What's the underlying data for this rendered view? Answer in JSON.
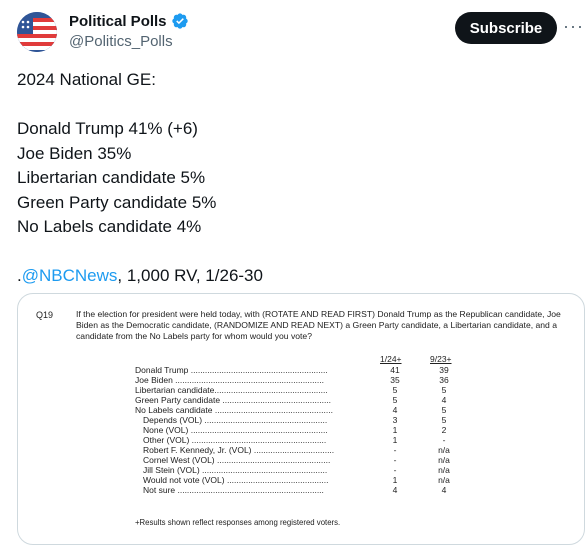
{
  "author": {
    "display_name": "Political Polls",
    "handle": "@Politics_Polls"
  },
  "actions": {
    "subscribe_label": "Subscribe",
    "more_label": "···"
  },
  "tweet": {
    "line1": "2024 National GE:",
    "line2": "Donald Trump 41% (+6)",
    "line3": "Joe Biden 35%",
    "line4": "Libertarian candidate 5%",
    "line5": "Green Party candidate 5%",
    "line6": "No Labels candidate 4%",
    "source_prefix": ".",
    "mention": "@NBCNews",
    "source_suffix": ", 1,000 RV, 1/26-30"
  },
  "colors": {
    "accent": "#1d9bf0",
    "text": "#0f1419",
    "muted": "#536471",
    "verified": "#1d9bf0"
  },
  "poll_image": {
    "question_number": "Q19",
    "question_text": "If the election for president were held today, with (ROTATE AND READ FIRST) Donald Trump as the Republican candidate, Joe Biden as the Democratic candidate, (RANDOMIZE AND READ NEXT) a Green Party candidate, a Libertarian candidate, and a candidate from the No Labels party for whom would you vote?",
    "col1_header": "1/24+",
    "col2_header": "9/23+",
    "rows": [
      {
        "label": "Donald Trump ..........................................................",
        "v1": "41",
        "v2": "39"
      },
      {
        "label": "Joe Biden ...............................................................",
        "v1": "35",
        "v2": "36"
      },
      {
        "label": "Libertarian candidate................................................",
        "v1": "5",
        "v2": "5"
      },
      {
        "label": "Green Party candidate ..............................................",
        "v1": "5",
        "v2": "4"
      },
      {
        "label": "No Labels candidate ..................................................",
        "v1": "4",
        "v2": "5"
      },
      {
        "label": "Depends (VOL) ....................................................",
        "v1": "3",
        "v2": "5"
      },
      {
        "label": "None (VOL) ..........................................................",
        "v1": "1",
        "v2": "2"
      },
      {
        "label": "Other (VOL) .........................................................",
        "v1": "1",
        "v2": "-"
      },
      {
        "label": "Robert F. Kennedy, Jr. (VOL) ..................................",
        "v1": "-",
        "v2": "n/a"
      },
      {
        "label": "Cornel West (VOL) ................................................",
        "v1": "-",
        "v2": "n/a"
      },
      {
        "label": "Jill Stein (VOL) .....................................................",
        "v1": "-",
        "v2": "n/a"
      },
      {
        "label": "Would not vote (VOL) ...........................................",
        "v1": "1",
        "v2": "n/a"
      },
      {
        "label": "Not sure ..............................................................",
        "v1": "4",
        "v2": "4"
      }
    ],
    "footnote": "+Results shown reflect responses among registered voters."
  }
}
